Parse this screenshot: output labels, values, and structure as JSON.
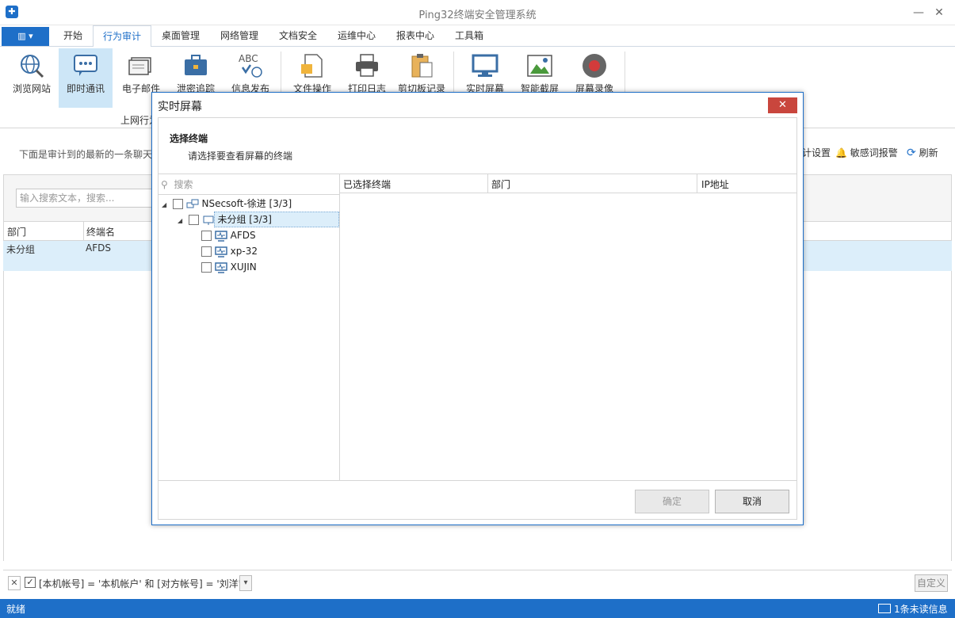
{
  "window": {
    "title": "Ping32终端安全管理系统",
    "app_icon": "shield-icon"
  },
  "tabs": [
    {
      "label": "开始"
    },
    {
      "label": "行为审计",
      "active": true
    },
    {
      "label": "桌面管理"
    },
    {
      "label": "网络管理"
    },
    {
      "label": "文档安全"
    },
    {
      "label": "运维中心"
    },
    {
      "label": "报表中心"
    },
    {
      "label": "工具箱"
    }
  ],
  "ribbon": {
    "buttons": [
      {
        "label": "浏览网站",
        "icon": "globe-search-icon"
      },
      {
        "label": "即时通讯",
        "icon": "chat-icon",
        "active": true
      },
      {
        "label": "电子邮件",
        "icon": "email-icon"
      },
      {
        "label": "泄密追踪",
        "icon": "briefcase-icon"
      },
      {
        "label": "信息发布",
        "icon": "abc-globe-icon"
      },
      {
        "label": "文件操作",
        "icon": "file-icon"
      },
      {
        "label": "打印日志",
        "icon": "printer-icon"
      },
      {
        "label": "剪切板记录",
        "icon": "clipboard-icon"
      },
      {
        "label": "实时屏幕",
        "icon": "monitor-icon"
      },
      {
        "label": "智能截屏",
        "icon": "picture-icon"
      },
      {
        "label": "屏幕录像",
        "icon": "record-icon"
      }
    ],
    "group_label": "上网行为"
  },
  "content": {
    "info_text": "下面是审计到的最新的一条聊天",
    "sensitive_settings": "计设置",
    "sensitive_alert": "敏感词报警",
    "refresh": "刷新",
    "search_placeholder": "输入搜索文本，搜索...",
    "grid": {
      "columns": [
        "部门",
        "终端名"
      ],
      "rows": [
        [
          "未分组",
          "AFDS"
        ]
      ]
    }
  },
  "filter": {
    "expression": "[本机帐号] = '本机帐户' 和 [对方帐号] = '刘洋'",
    "checked": true,
    "custom_label": "自定义"
  },
  "status": {
    "text": "就绪",
    "messages": "1条未读信息"
  },
  "dialog": {
    "title": "实时屏幕",
    "heading": "选择终端",
    "subheading": "请选择要查看屏幕的终端",
    "search_placeholder": "搜索",
    "tree": {
      "root": "NSecsoft-徐进  [3/3]",
      "group": "未分组  [3/3]",
      "items": [
        "AFDS",
        "xp-32",
        "XUJIN"
      ]
    },
    "selected_columns": [
      "已选择终端",
      "部门",
      "IP地址"
    ],
    "ok_label": "确定",
    "cancel_label": "取消"
  },
  "colors": {
    "accent": "#1e6fc8",
    "close": "#c9463d",
    "selection": "#dceefa"
  }
}
